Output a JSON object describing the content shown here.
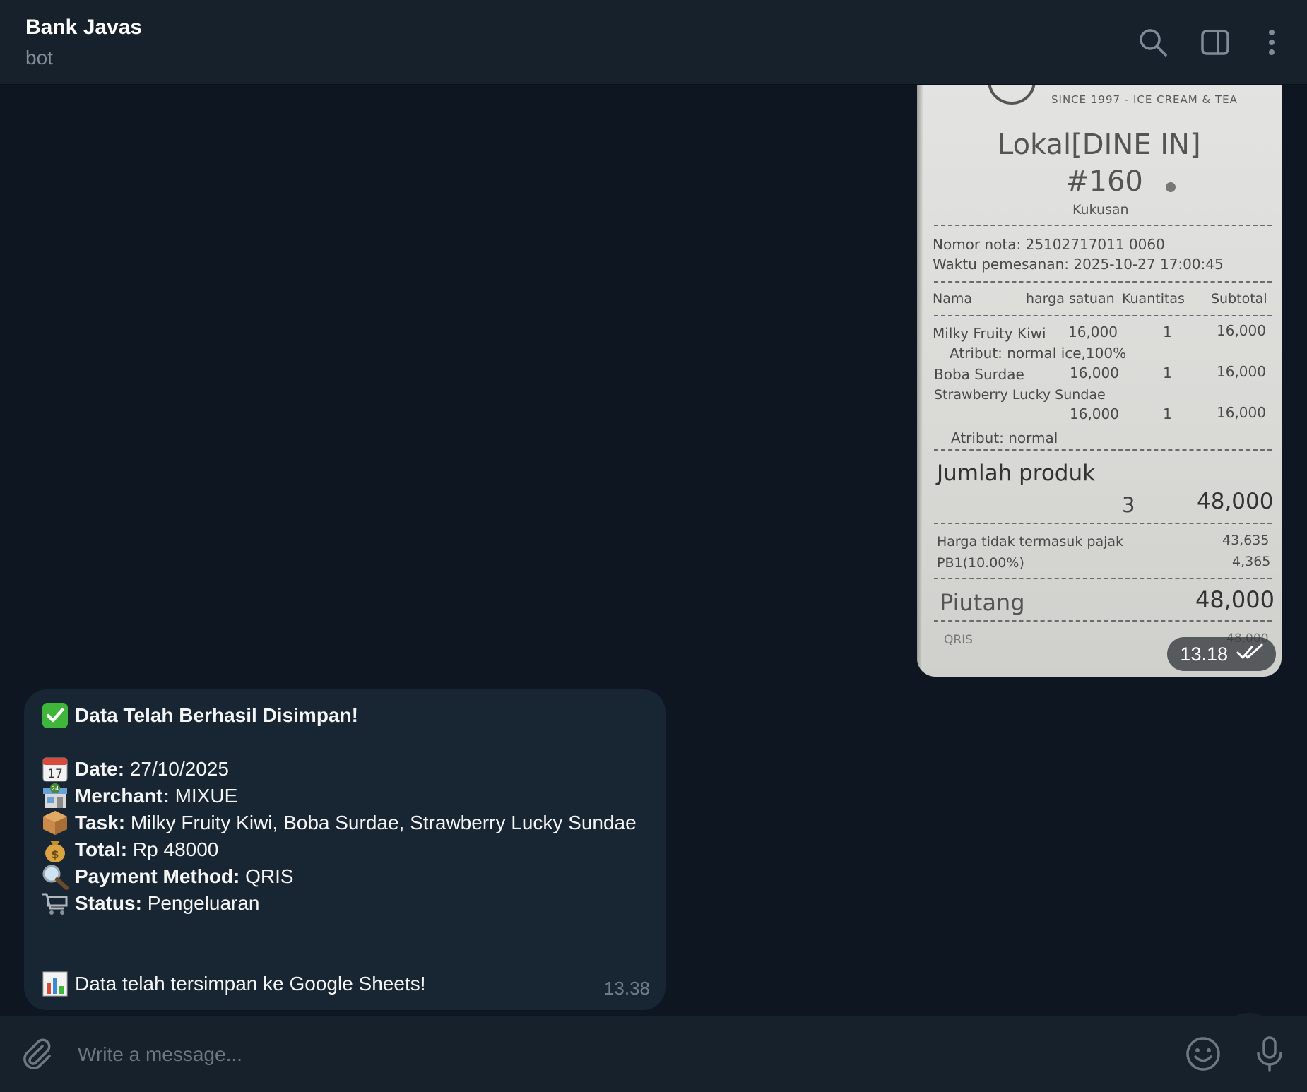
{
  "colors": {
    "background": "#0e1621",
    "header": "#17212b",
    "bubble": "#182533",
    "muted": "#6d7f8f"
  },
  "header": {
    "title": "Bank Javas",
    "subtitle": "bot",
    "icons": [
      "search-icon",
      "sidebar-toggle-icon",
      "more-vertical-icon"
    ]
  },
  "receipt": {
    "since": "SINCE 1997 - ICE CREAM & TEA",
    "order_type": "Lokal[DINE IN]",
    "order_no": "#160",
    "branch": "Kukusan",
    "nota": "Nomor nota: 25102717011 0060",
    "waktu": "Waktu pemesanan: 2025-10-27 17:00:45",
    "columns": [
      "Nama",
      "harga satuan",
      "Kuantitas",
      "Subtotal"
    ],
    "items": [
      {
        "name": "Milky Fruity Kiwi",
        "price": "16,000",
        "qty": "1",
        "subtotal": "16,000",
        "attr": "Atribut: normal ice,100%"
      },
      {
        "name": "Boba Surdae",
        "price": "16,000",
        "qty": "1",
        "subtotal": "16,000",
        "attr": ""
      },
      {
        "name": "Strawberry Lucky Sundae",
        "price": "16,000",
        "qty": "1",
        "subtotal": "16,000",
        "attr": "Atribut: normal"
      }
    ],
    "jumlah_label": "Jumlah produk",
    "jumlah_qty": "3",
    "jumlah_total": "48,000",
    "pajak_label": "Harga tidak termasuk pajak",
    "pajak_value": "43,635",
    "pb1_label": "PB1(10.00%)",
    "pb1_value": "4,365",
    "piutang_label": "Piutang",
    "piutang_value": "48,000",
    "qris_label": "QRIS",
    "qris_value": "48,000",
    "sent_time": "13.18"
  },
  "message": {
    "title": "Data Telah Berhasil Disimpan!",
    "fields": [
      {
        "icon": "calendar-icon",
        "label": "Date:",
        "value": "27/10/2025"
      },
      {
        "icon": "store-icon",
        "label": "Merchant:",
        "value": "MIXUE"
      },
      {
        "icon": "package-icon",
        "label": "Task:",
        "value": "Milky Fruity Kiwi, Boba Surdae, Strawberry Lucky Sundae"
      },
      {
        "icon": "money-bag-icon",
        "label": "Total:",
        "value": "Rp 48000"
      },
      {
        "icon": "magnifier-icon",
        "label": "Payment Method:",
        "value": "QRIS"
      },
      {
        "icon": "cart-icon",
        "label": "Status:",
        "value": "Pengeluaran"
      }
    ],
    "footer": "Data telah tersimpan ke Google Sheets!",
    "time": "13.38"
  },
  "composer": {
    "placeholder": "Write a message...",
    "icons": [
      "attach-icon",
      "emoji-icon",
      "microphone-icon"
    ]
  }
}
